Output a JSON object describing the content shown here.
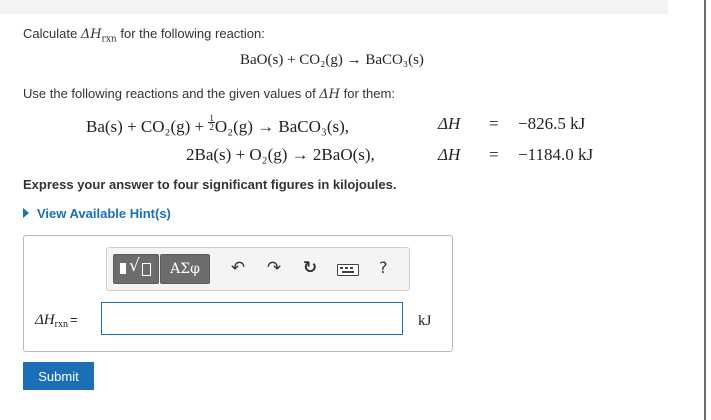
{
  "problem": {
    "prompt_prefix": "Calculate ",
    "prompt_dh": "ΔH",
    "prompt_sub": "rxn",
    "prompt_suffix": " for the following reaction:",
    "target_reaction": "BaO(s) + CO₂(g) → BaCO₃(s)",
    "use_text_prefix": "Use the following reactions and the given values of ",
    "use_text_dh": "ΔH",
    "use_text_suffix": " for them:",
    "reaction1_lhs_a": "Ba(s) + CO₂(g) + ",
    "reaction1_frac_num": "1",
    "reaction1_frac_den": "2",
    "reaction1_lhs_b": "O₂(g) → BaCO₃(s),",
    "reaction1_dh": "ΔH",
    "reaction1_eq": "=",
    "reaction1_value": "−826.5 kJ",
    "reaction2_lhs": "2Ba(s) + O₂(g) → 2BaO(s),",
    "reaction2_dh": "ΔH",
    "reaction2_eq": "=",
    "reaction2_value": "−1184.0 kJ",
    "instruction": "Express your answer to four significant figures in kilojoules.",
    "hint_link": "View Available Hint(s)"
  },
  "toolbar": {
    "greek_label": "ΑΣφ",
    "undo_icon": "↶",
    "redo_icon": "↷",
    "reset_icon": "↻",
    "help_label": "?"
  },
  "answer": {
    "label_dh": "ΔH",
    "label_sub": "rxn",
    "label_eq": "=",
    "value": "",
    "unit": "kJ"
  },
  "submit_label": "Submit",
  "colors": {
    "accent": "#1a6fb5",
    "toolbar_button": "#6c6c6c"
  }
}
